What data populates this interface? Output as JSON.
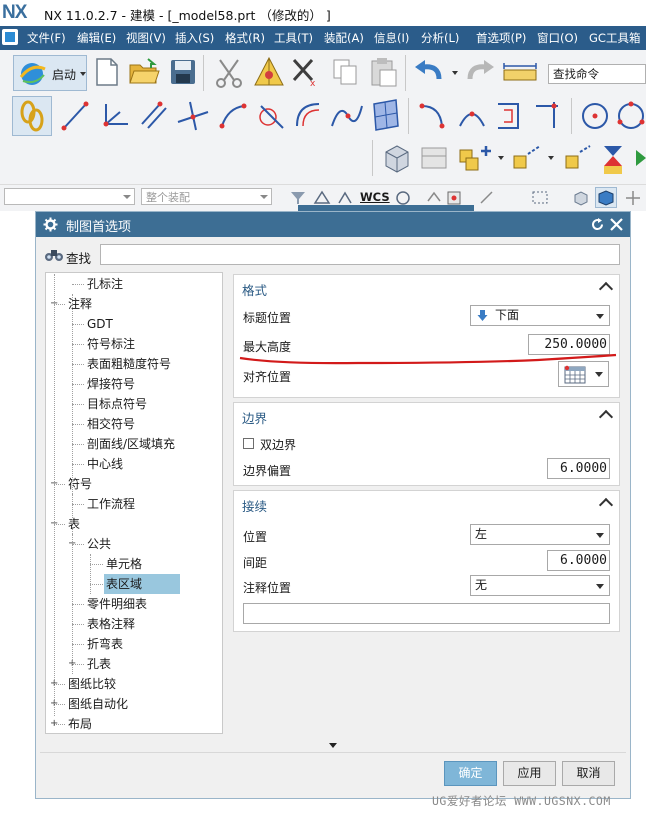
{
  "window": {
    "logo": "NX",
    "title": "NX 11.0.2.7 - 建模 - [_model58.prt （修改的）  ]"
  },
  "menubar": {
    "items": [
      "文件(F)",
      "编辑(E)",
      "视图(V)",
      "插入(S)",
      "格式(R)",
      "工具(T)",
      "装配(A)",
      "信息(I)",
      "分析(L)",
      "首选项(P)",
      "窗口(O)",
      "GC工具箱"
    ]
  },
  "toolbar": {
    "start_label": "启动",
    "command_search_placeholder": "查找命令"
  },
  "selection_bar": {
    "filter_value": "",
    "scope_value": "整个装配",
    "wcs_label": "WCS"
  },
  "dialog": {
    "title": "制图首选项",
    "search_label": "查找",
    "search_value": "",
    "tree": [
      {
        "label": "孔标注",
        "depth": 2
      },
      {
        "label": "注释",
        "depth": 1,
        "toggle": "−"
      },
      {
        "label": "GDT",
        "depth": 2
      },
      {
        "label": "符号标注",
        "depth": 2
      },
      {
        "label": "表面粗糙度符号",
        "depth": 2
      },
      {
        "label": "焊接符号",
        "depth": 2
      },
      {
        "label": "目标点符号",
        "depth": 2
      },
      {
        "label": "相交符号",
        "depth": 2
      },
      {
        "label": "剖面线/区域填充",
        "depth": 2
      },
      {
        "label": "中心线",
        "depth": 2
      },
      {
        "label": "符号",
        "depth": 1,
        "toggle": "−"
      },
      {
        "label": "工作流程",
        "depth": 2
      },
      {
        "label": "表",
        "depth": 1,
        "toggle": "−"
      },
      {
        "label": "公共",
        "depth": 2,
        "toggle": "−"
      },
      {
        "label": "单元格",
        "depth": 3
      },
      {
        "label": "表区域",
        "depth": 3,
        "selected": true
      },
      {
        "label": "零件明细表",
        "depth": 2
      },
      {
        "label": "表格注释",
        "depth": 2
      },
      {
        "label": "折弯表",
        "depth": 2
      },
      {
        "label": "孔表",
        "depth": 2,
        "toggle": "+"
      },
      {
        "label": "图纸比较",
        "depth": 1,
        "toggle": "+"
      },
      {
        "label": "图纸自动化",
        "depth": 1,
        "toggle": "+"
      },
      {
        "label": "布局",
        "depth": 1,
        "toggle": "+"
      }
    ],
    "format_group": {
      "title": "格式",
      "caption_position_label": "标题位置",
      "caption_position_value": "下面",
      "max_height_label": "最大高度",
      "max_height_value": "250.0000",
      "alignment_label": "对齐位置"
    },
    "border_group": {
      "title": "边界",
      "double_border_label": "双边界",
      "double_border_checked": false,
      "border_offset_label": "边界偏置",
      "border_offset_value": "6.0000"
    },
    "continuation_group": {
      "title": "接续",
      "position_label": "位置",
      "position_value": "左",
      "spacing_label": "间距",
      "spacing_value": "6.0000",
      "note_position_label": "注释位置",
      "note_position_value": "无",
      "note_text_value": ""
    },
    "buttons": {
      "ok": "确定",
      "apply": "应用",
      "cancel": "取消"
    }
  },
  "colors": {
    "menubar": "#2b5c8a",
    "dialog_title": "#3d6e94",
    "group_title": "#2a5a84",
    "tree_selected": "#99c7de",
    "annotation_underline": "#d21a1a"
  },
  "watermark": "UG爱好者论坛 WWW.UGSNX.COM"
}
